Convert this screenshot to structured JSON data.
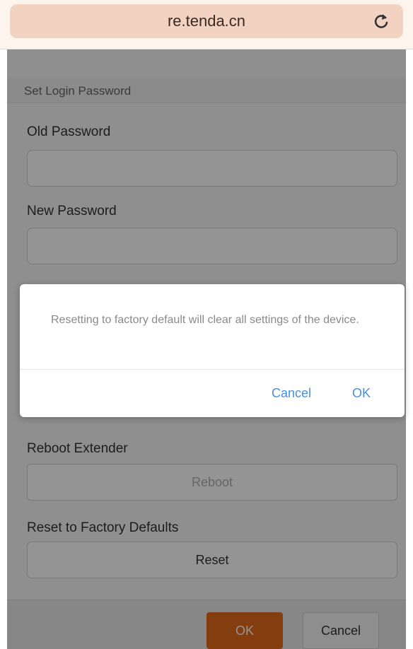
{
  "browser": {
    "url": "re.tenda.cn",
    "reload_icon": "reload-icon"
  },
  "page": {
    "section_title": "Set Login Password",
    "old_password_label": "Old Password",
    "old_password_value": "",
    "new_password_label": "New Password",
    "new_password_value": "",
    "reboot_label": "Reboot Extender",
    "reboot_button": "Reboot",
    "reset_label": "Reset to Factory Defaults",
    "reset_button": "Reset"
  },
  "footer": {
    "ok_label": "OK",
    "cancel_label": "Cancel"
  },
  "dialog": {
    "message": "Resetting to factory default will clear all settings of the device.",
    "cancel_label": "Cancel",
    "ok_label": "OK"
  },
  "colors": {
    "accent": "#e36a19",
    "dialog_link": "#4a8ee0",
    "address_bar": "#f2d3c1"
  }
}
